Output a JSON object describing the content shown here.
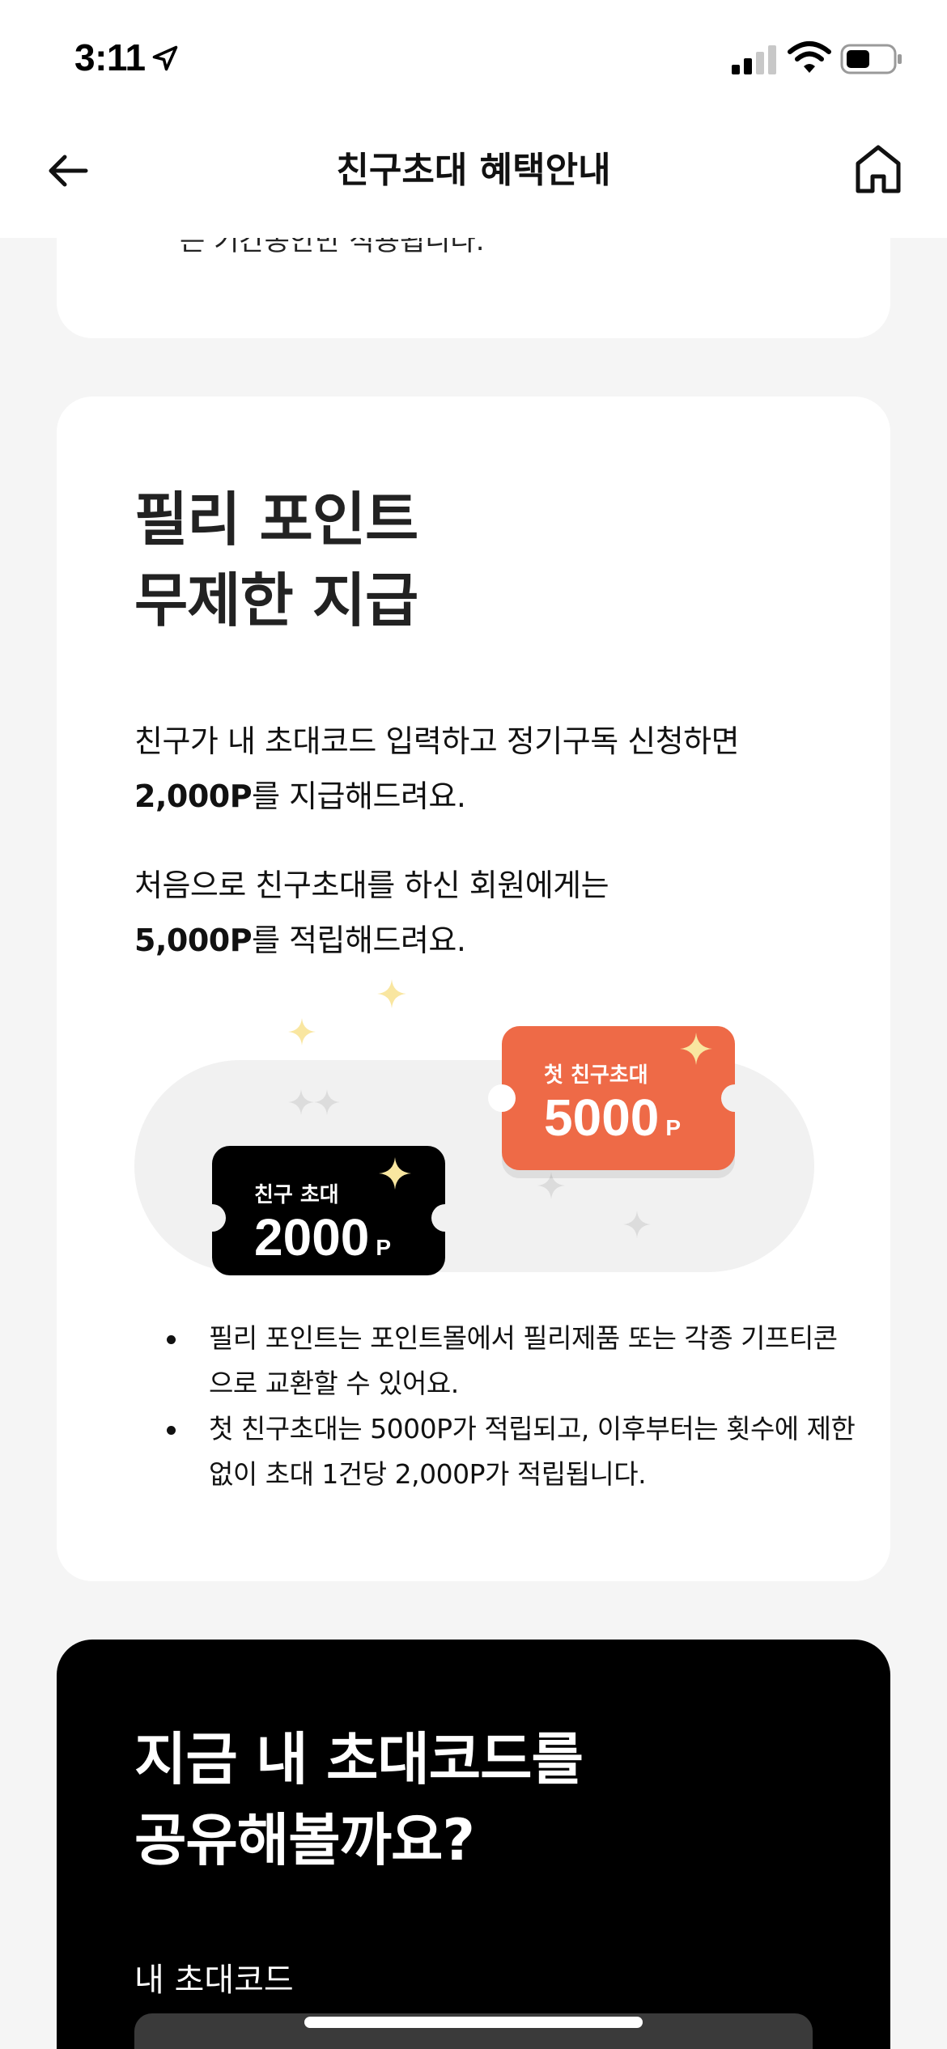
{
  "status_bar": {
    "time": "3:11",
    "icons": [
      "location-arrow-icon",
      "cell-signal-icon",
      "wifi-icon",
      "battery-icon"
    ]
  },
  "nav": {
    "title": "친구초대 혜택안내",
    "back_icon": "back-arrow-icon",
    "home_icon": "home-icon"
  },
  "previous_card": {
    "partial_text": "는 기간동안만 적용됩니다."
  },
  "points_card": {
    "title_line1": "필리 포인트",
    "title_line2": "무제한 지급",
    "para1_line1": "친구가 내 초대코드 입력하고 정기구독 신청하면",
    "para1_bold": "2,000P",
    "para1_rest": "를 지급해드려요.",
    "para2_line1": "처음으로 친구초대를 하신 회원에게는",
    "para2_bold": "5,000P",
    "para2_rest": "를 적립해드려요.",
    "ticket_black": {
      "label": "친구 초대",
      "value": "2000",
      "unit": "P"
    },
    "ticket_orange": {
      "label": "첫 친구초대",
      "value": "5000",
      "unit": "P"
    },
    "bullets": [
      "필리 포인트는 포인트몰에서 필리제품 또는 각종 기프티콘으로 교환할 수 있어요.",
      "첫  친구초대는 5000P가 적립되고, 이후부터는 횟수에 제한없이 초대 1건당 2,000P가 적립됩니다."
    ]
  },
  "share_card": {
    "title_line1": "지금 내 초대코드를",
    "title_line2": "공유해볼까요?",
    "code_label": "내 초대코드"
  },
  "colors": {
    "accent_orange": "#ee6a47",
    "sparkle_yellow": "#f9e6a0",
    "background": "#f5f5f5",
    "card_dark": "#000000"
  }
}
